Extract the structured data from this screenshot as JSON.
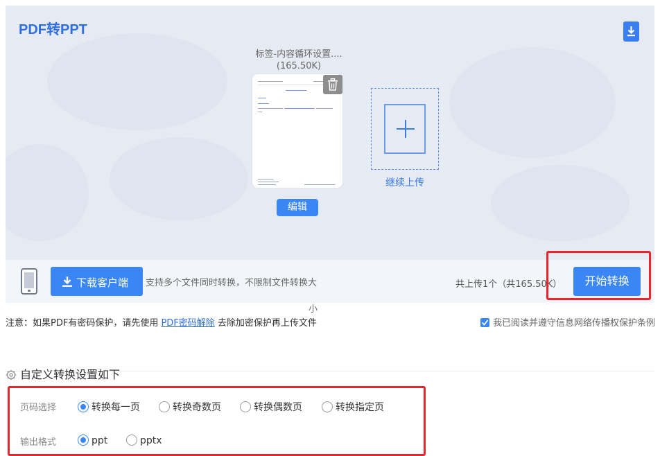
{
  "panel": {
    "title": "PDF转PPT",
    "download_icon": "download-icon"
  },
  "file": {
    "name": "标签-内容循环设置....",
    "size": "(165.50K)",
    "edit_label": "编辑",
    "delete_icon": "trash-icon"
  },
  "add": {
    "label": "继续上传",
    "icon": "plus-icon"
  },
  "bar": {
    "device_icon": "phone-icon",
    "client_button": "下载客户端",
    "hint": "支持多个文件同时转换，不限制文件转换大",
    "hint_tail": "小",
    "upload_count": "共上传1个（共165.50K）",
    "start_button": "开始转换"
  },
  "note": {
    "prefix": "注意：如果PDF有密码保护，请先使用 ",
    "link": "PDF密码解除",
    "suffix": " 去除加密保护再上传文件"
  },
  "agree": {
    "checked": true,
    "label": "我已阅读并遵守信息网络传播权保护条例"
  },
  "settings": {
    "title": "自定义转换设置如下",
    "icon": "gear-icon",
    "page_label": "页码选择",
    "page_options": [
      "转换每一页",
      "转换奇数页",
      "转换偶数页",
      "转换指定页"
    ],
    "page_selected": "转换每一页",
    "format_label": "输出格式",
    "format_options": [
      "ppt",
      "pptx"
    ],
    "format_selected": "ppt"
  },
  "colors": {
    "accent": "#3a86f5",
    "highlight": "#e8242d",
    "panel_bg": "#e6ebf3"
  }
}
